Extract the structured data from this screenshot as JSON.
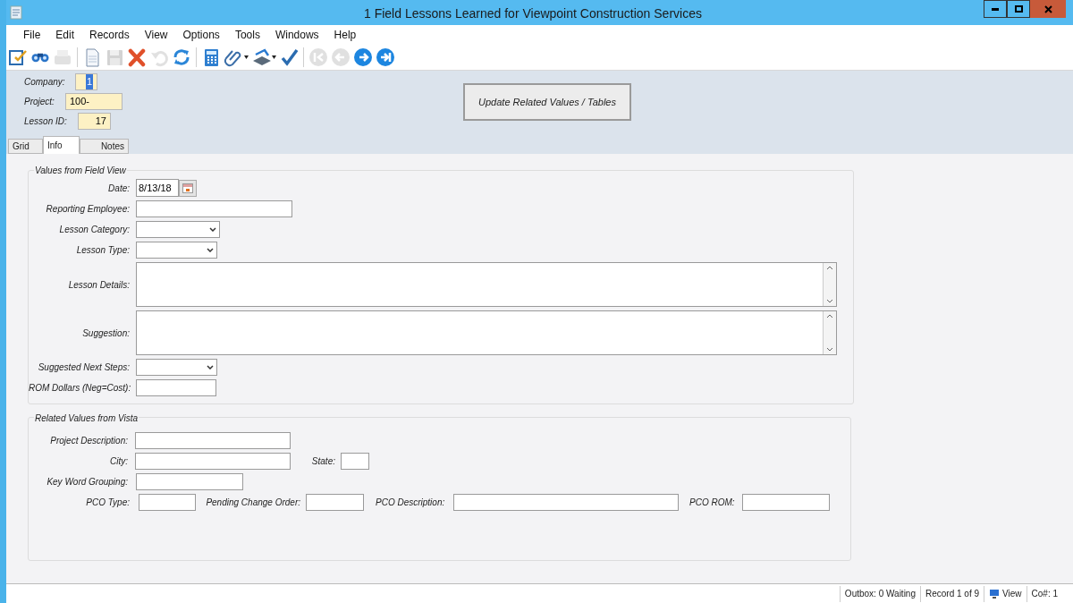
{
  "window": {
    "title": "1 Field Lessons Learned for Viewpoint Construction Services"
  },
  "menu": [
    "File",
    "Edit",
    "Records",
    "View",
    "Options",
    "Tools",
    "Windows",
    "Help"
  ],
  "toolbar": [
    {
      "kind": "edit",
      "disabled": false
    },
    {
      "kind": "find",
      "disabled": false
    },
    {
      "kind": "print",
      "disabled": true
    },
    {
      "kind": "separator"
    },
    {
      "kind": "new",
      "disabled": false
    },
    {
      "kind": "save",
      "disabled": true
    },
    {
      "kind": "delete",
      "disabled": false
    },
    {
      "kind": "undo",
      "disabled": true
    },
    {
      "kind": "refresh",
      "disabled": false
    },
    {
      "kind": "separator"
    },
    {
      "kind": "calculator",
      "disabled": false
    },
    {
      "kind": "attach",
      "disabled": false
    },
    {
      "kind": "scan",
      "disabled": false
    },
    {
      "kind": "spellcheck",
      "disabled": false
    },
    {
      "kind": "separator"
    },
    {
      "kind": "first",
      "disabled": true
    },
    {
      "kind": "prev",
      "disabled": true
    },
    {
      "kind": "next",
      "disabled": false
    },
    {
      "kind": "last",
      "disabled": false
    }
  ],
  "header_fields": [
    {
      "label": "Company:",
      "value": "1",
      "selected": true
    },
    {
      "label": "Project:",
      "value": "100-",
      "selected": false
    },
    {
      "label": "Lesson ID:",
      "value": "17",
      "selected": false
    }
  ],
  "update_button": "Update Related Values / Tables",
  "tabs": [
    {
      "label": "Grid",
      "selected": false
    },
    {
      "label": "Info",
      "selected": true
    },
    {
      "label": "Notes",
      "selected": false
    }
  ],
  "field_view": {
    "title": "Values from Field View",
    "fields": [
      {
        "label": "Date:",
        "kind": "date",
        "value": "8/13/18"
      },
      {
        "label": "Reporting Employee:",
        "kind": "text"
      },
      {
        "label": "Lesson Category:",
        "kind": "select"
      },
      {
        "label": "Lesson Type:",
        "kind": "select"
      },
      {
        "label": "Lesson Details:",
        "kind": "textarea"
      },
      {
        "label": "Suggestion:",
        "kind": "textarea"
      },
      {
        "label": "Suggested Next Steps:",
        "kind": "select"
      },
      {
        "label": "ROM Dollars (Neg=Cost):",
        "kind": "text"
      }
    ]
  },
  "vista": {
    "title": "Related Values from Vista",
    "rows": [
      [
        "Project Description:"
      ],
      [
        "City:",
        "State:"
      ],
      [
        "Key Word Grouping:"
      ],
      [
        "PCO Type:",
        "Pending Change Order:",
        "PCO Description:",
        "PCO ROM:"
      ]
    ]
  },
  "status_bar": [
    "Outbox: 0 Waiting",
    "Record 1 of 9",
    "View",
    "Co#: 1"
  ]
}
